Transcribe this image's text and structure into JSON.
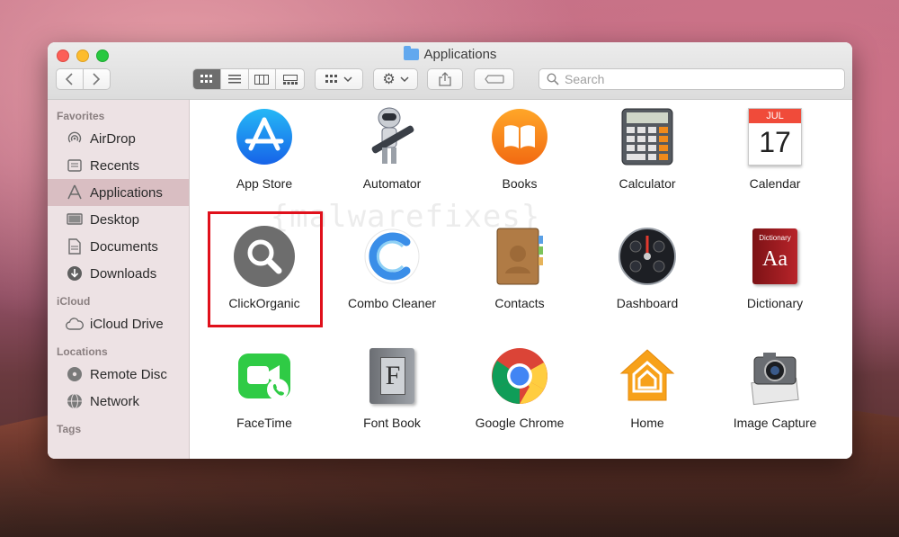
{
  "window": {
    "title": "Applications"
  },
  "toolbar": {
    "search_placeholder": "Search"
  },
  "sidebar": {
    "sections": [
      {
        "heading": "Favorites",
        "items": [
          {
            "label": "AirDrop",
            "icon": "airdrop-icon"
          },
          {
            "label": "Recents",
            "icon": "clock-icon"
          },
          {
            "label": "Applications",
            "icon": "applications-icon",
            "selected": true
          },
          {
            "label": "Desktop",
            "icon": "desktop-icon"
          },
          {
            "label": "Documents",
            "icon": "document-icon"
          },
          {
            "label": "Downloads",
            "icon": "download-icon"
          }
        ]
      },
      {
        "heading": "iCloud",
        "items": [
          {
            "label": "iCloud Drive",
            "icon": "cloud-icon"
          }
        ]
      },
      {
        "heading": "Locations",
        "items": [
          {
            "label": "Remote Disc",
            "icon": "disc-icon"
          },
          {
            "label": "Network",
            "icon": "globe-icon"
          }
        ]
      },
      {
        "heading": "Tags",
        "items": []
      }
    ]
  },
  "apps": [
    {
      "label": "App Store",
      "icon": "app-store-icon"
    },
    {
      "label": "Automator",
      "icon": "automator-icon"
    },
    {
      "label": "Books",
      "icon": "books-icon"
    },
    {
      "label": "Calculator",
      "icon": "calculator-icon"
    },
    {
      "label": "Calendar",
      "icon": "calendar-icon",
      "month": "JUL",
      "day": "17"
    },
    {
      "label": "ClickOrganic",
      "icon": "clickorganic-icon",
      "highlighted": true
    },
    {
      "label": "Combo Cleaner",
      "icon": "combo-cleaner-icon"
    },
    {
      "label": "Contacts",
      "icon": "contacts-icon"
    },
    {
      "label": "Dashboard",
      "icon": "dashboard-icon"
    },
    {
      "label": "Dictionary",
      "icon": "dictionary-icon",
      "cover_text": "Aa",
      "cover_small": "Dictionary"
    },
    {
      "label": "FaceTime",
      "icon": "facetime-icon"
    },
    {
      "label": "Font Book",
      "icon": "font-book-icon",
      "glyph": "F"
    },
    {
      "label": "Google Chrome",
      "icon": "chrome-icon"
    },
    {
      "label": "Home",
      "icon": "home-icon"
    },
    {
      "label": "Image Capture",
      "icon": "image-capture-icon"
    }
  ],
  "watermark": "{malwarefixes}",
  "colors": {
    "highlight": "#e0101b",
    "selection": "#d6babe",
    "accent": "#62a8ee"
  }
}
